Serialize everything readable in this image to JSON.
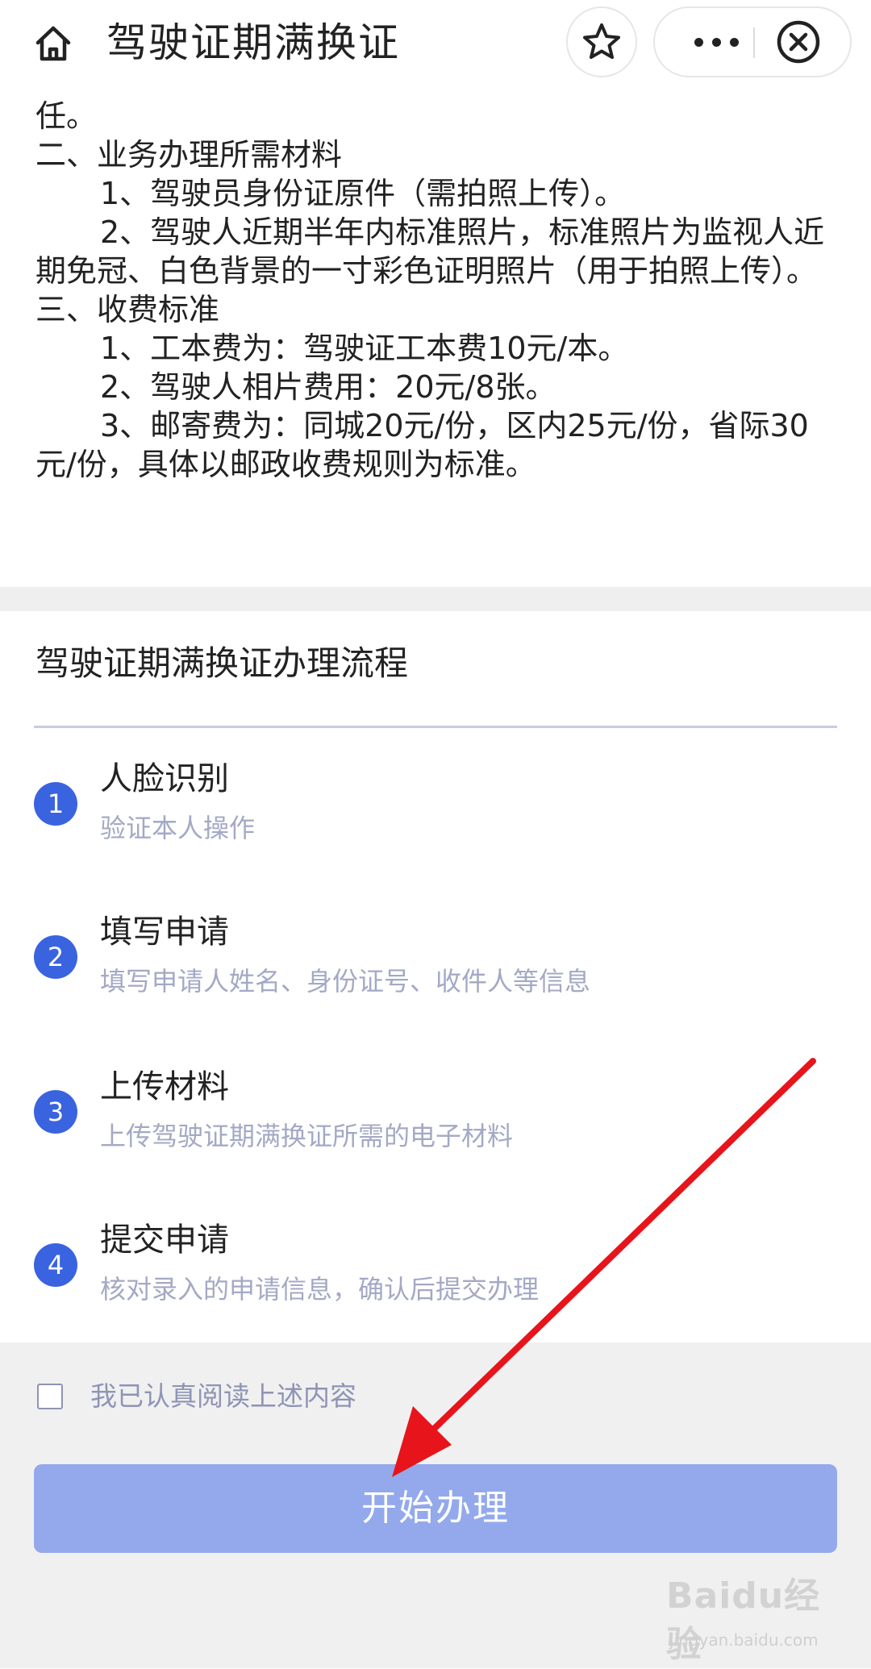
{
  "header": {
    "title": "驾驶证期满换证",
    "icons": {
      "home": "home-icon",
      "favorite": "star-icon",
      "more": "more-icon",
      "close": "close-icon"
    }
  },
  "content": {
    "lines": [
      "任。",
      "二、业务办理所需材料",
      "1、驾驶员身份证原件（需拍照上传）。",
      "2、驾驶人近期半年内标准照片，标准照片为监视人近期免冠、白色背景的一寸彩色证明照片（用于拍照上传）。",
      "三、收费标准",
      "1、工本费为：驾驶证工本费10元/本。",
      "2、驾驶人相片费用：20元/8张。",
      "3、邮寄费为：同城20元/份，区内25元/份，省际30元/份，具体以邮政收费规则为标准。"
    ]
  },
  "process": {
    "title": "驾驶证期满换证办理流程",
    "steps": [
      {
        "num": "1",
        "title": "人脸识别",
        "desc": "验证本人操作"
      },
      {
        "num": "2",
        "title": "填写申请",
        "desc": "填写申请人姓名、身份证号、收件人等信息"
      },
      {
        "num": "3",
        "title": "上传材料",
        "desc": "上传驾驶证期满换证所需的电子材料"
      },
      {
        "num": "4",
        "title": "提交申请",
        "desc": "核对录入的申请信息，确认后提交办理"
      }
    ]
  },
  "footer": {
    "agree_label": "我已认真阅读上述内容",
    "agree_checked": false,
    "start_button": "开始办理"
  },
  "watermark": {
    "main": "Baidu经验",
    "sub": "jingyan.baidu.com"
  },
  "colors": {
    "accent": "#3a63e0",
    "button": "#93a9ec",
    "muted_text": "#a3a9c5",
    "arrow": "#e8141b"
  }
}
